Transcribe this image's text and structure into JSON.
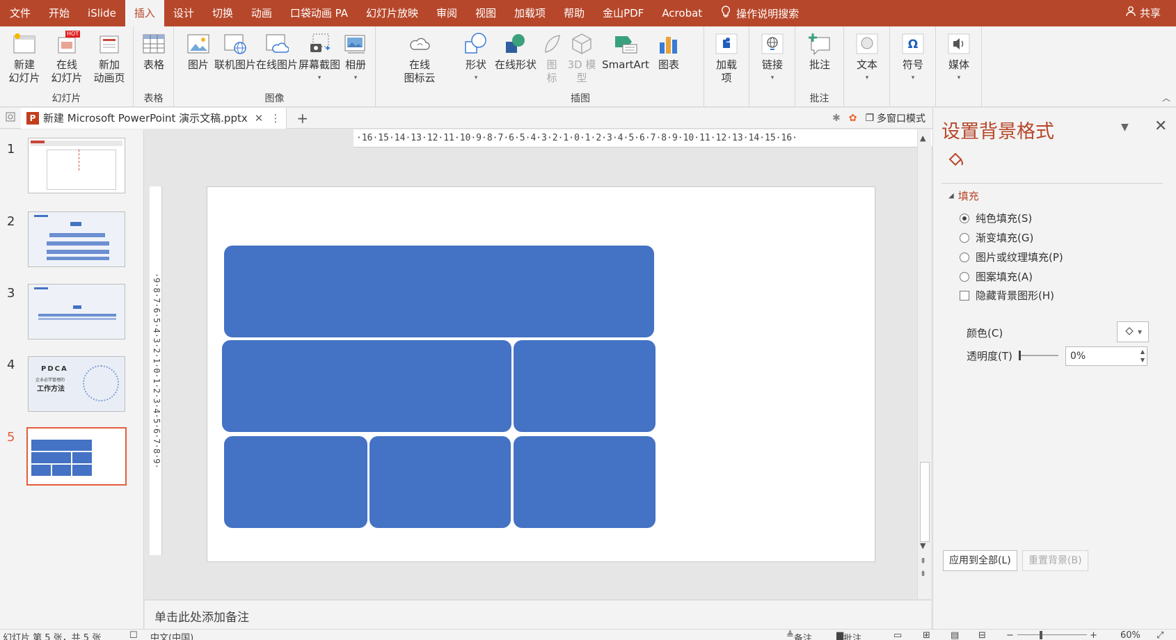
{
  "menubar": {
    "tabs": [
      "文件",
      "开始",
      "iSlide",
      "插入",
      "设计",
      "切换",
      "动画",
      "口袋动画 PA",
      "幻灯片放映",
      "审阅",
      "视图",
      "加载项",
      "帮助",
      "金山PDF",
      "Acrobat"
    ],
    "active_tab": "插入",
    "search_label": "操作说明搜索",
    "share_label": "共享"
  },
  "ribbon": {
    "groups": {
      "slides": "幻灯片",
      "table": "表格",
      "images": "图像",
      "illustrations": "插图",
      "comments": "批注"
    },
    "buttons": {
      "new_slide": "新建\n幻灯片",
      "online_slide": "在线\n幻灯片",
      "new_anim_page": "新加\n动画页",
      "table": "表格",
      "picture": "图片",
      "online_picture_link": "联机图片",
      "online_picture": "在线图片",
      "screenshot": "屏幕截图",
      "album": "相册",
      "online_icon_cloud": "在线\n图标云",
      "shapes": "形状",
      "online_shapes": "在线形状",
      "icons": "图\n标",
      "model_3d": "3D 模\n型",
      "smartart": "SmartArt",
      "chart": "图表",
      "addins": "加载\n项",
      "link": "链接",
      "comment": "批注",
      "text": "文本",
      "symbols": "符号",
      "media": "媒体"
    },
    "hot_badge": "HOT"
  },
  "docbar": {
    "file_name": "新建 Microsoft PowerPoint 演示文稿.pptx",
    "ppt_icon_letter": "P",
    "multiwindow_label": "多窗口模式"
  },
  "thumbnails": {
    "numbers": [
      "1",
      "2",
      "3",
      "4",
      "5"
    ],
    "active": "5",
    "slide4_title": "PDCA",
    "slide4_sub1": "企业必学管理的",
    "slide4_sub2": "工作方法"
  },
  "rulers": {
    "horizontal": "·16·15·14·13·12·11·10·9·8·7·6·5·4·3·2·1·0·1·2·3·4·5·6·7·8·9·10·11·12·13·14·15·16·",
    "vertical": "·9·8·7·6·5·4·3·2·1·0·1·2·3·4·5·6·7·8·9·"
  },
  "notes": {
    "placeholder": "单击此处添加备注"
  },
  "format_pane": {
    "title": "设置背景格式",
    "section": "填充",
    "options": [
      {
        "label": "纯色填充(S)",
        "type": "radio",
        "checked": true
      },
      {
        "label": "渐变填充(G)",
        "type": "radio",
        "checked": false
      },
      {
        "label": "图片或纹理填充(P)",
        "type": "radio",
        "checked": false
      },
      {
        "label": "图案填充(A)",
        "type": "radio",
        "checked": false
      },
      {
        "label": "隐藏背景图形(H)",
        "type": "checkbox",
        "checked": false
      }
    ],
    "color_label": "颜色(C)",
    "transparency_label": "透明度(T)",
    "transparency_value": "0%",
    "transparency_level": 0,
    "apply_all_label": "应用到全部(L)",
    "reset_label": "重置背景(B)"
  },
  "status": {
    "slide_info": "幻灯片 第 5 张，共 5 张",
    "language": "中文(中国)",
    "notes_label": "备注",
    "comments_label": "批注",
    "zoom": "60%"
  },
  "colors": {
    "accent": "#b7472a",
    "shape_fill": "#4472c4",
    "selection": "#e35d3b"
  }
}
